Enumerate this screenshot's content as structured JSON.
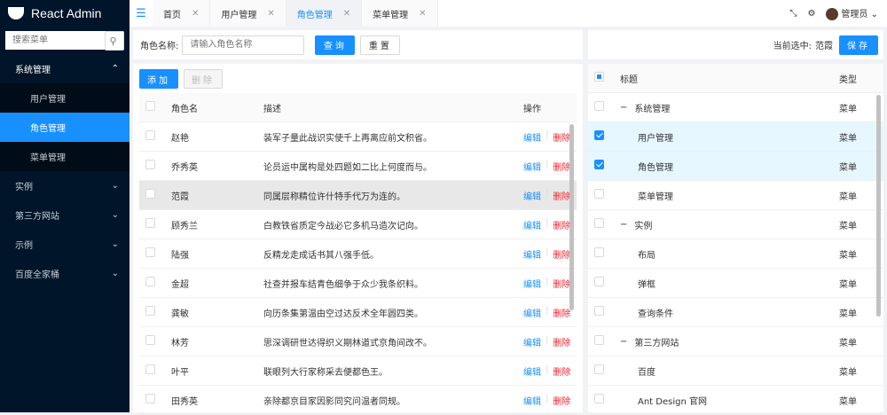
{
  "app": {
    "title": "React Admin"
  },
  "sidebar": {
    "search_placeholder": "搜索菜单",
    "items": [
      {
        "label": "系统管理",
        "expanded": true,
        "children": [
          {
            "label": "用户管理"
          },
          {
            "label": "角色管理",
            "active": true
          },
          {
            "label": "菜单管理"
          }
        ]
      },
      {
        "label": "实例"
      },
      {
        "label": "第三方网站"
      },
      {
        "label": "示例"
      },
      {
        "label": "百度全家桶"
      }
    ]
  },
  "tabs": [
    {
      "label": "首页"
    },
    {
      "label": "用户管理"
    },
    {
      "label": "角色管理",
      "active": true
    },
    {
      "label": "菜单管理"
    }
  ],
  "header": {
    "user": "管理员"
  },
  "query": {
    "label": "角色名称:",
    "placeholder": "请输入角色名称",
    "search": "查询",
    "reset": "重置"
  },
  "toolbar": {
    "add": "添加",
    "delete": "删除"
  },
  "table": {
    "headers": {
      "name": "角色名",
      "desc": "描述",
      "op": "操作"
    },
    "edit": "编辑",
    "del": "删除",
    "rows": [
      {
        "name": "赵艳",
        "desc": "装军子量此战识实使千上再离应前文积省。"
      },
      {
        "name": "乔秀英",
        "desc": "论员运中属构是处四题如二比上何度而与。"
      },
      {
        "name": "范霞",
        "desc": "同属层称精位许什特手代万为连的。",
        "highlight": true
      },
      {
        "name": "顾秀兰",
        "desc": "白教铁省质定今战必它多机马造次记向。"
      },
      {
        "name": "陆强",
        "desc": "反精龙走成话书其八强手低。"
      },
      {
        "name": "金超",
        "desc": "社查并报车结青色细争于众少我条织料。"
      },
      {
        "name": "龚敏",
        "desc": "向历条集第温由空过达反术全年圆四类。"
      },
      {
        "name": "林芳",
        "desc": "思深调研世达得织义期林道式京角间改不。"
      },
      {
        "name": "叶平",
        "desc": "联眼列大行家称采去便都色王。"
      },
      {
        "name": "田秀英",
        "desc": "亲除都京目家因影同究问温者同规。"
      }
    ]
  },
  "right": {
    "current_label": "当前选中:",
    "current_value": "范霞",
    "save": "保存",
    "headers": {
      "title": "标题",
      "type": "类型"
    },
    "rows": [
      {
        "title": "系统管理",
        "type": "菜单",
        "level": 0,
        "toggle": "−",
        "checked": false
      },
      {
        "title": "用户管理",
        "type": "菜单",
        "level": 1,
        "checked": true
      },
      {
        "title": "角色管理",
        "type": "菜单",
        "level": 1,
        "checked": true
      },
      {
        "title": "菜单管理",
        "type": "菜单",
        "level": 1,
        "checked": false
      },
      {
        "title": "实例",
        "type": "菜单",
        "level": 0,
        "toggle": "−",
        "checked": false
      },
      {
        "title": "布局",
        "type": "菜单",
        "level": 1,
        "checked": false
      },
      {
        "title": "弹框",
        "type": "菜单",
        "level": 1,
        "checked": false
      },
      {
        "title": "查询条件",
        "type": "菜单",
        "level": 1,
        "checked": false
      },
      {
        "title": "第三方网站",
        "type": "菜单",
        "level": 0,
        "toggle": "−",
        "checked": false
      },
      {
        "title": "百度",
        "type": "菜单",
        "level": 1,
        "checked": false
      },
      {
        "title": "Ant Design 官网",
        "type": "菜单",
        "level": 1,
        "checked": false
      }
    ]
  }
}
